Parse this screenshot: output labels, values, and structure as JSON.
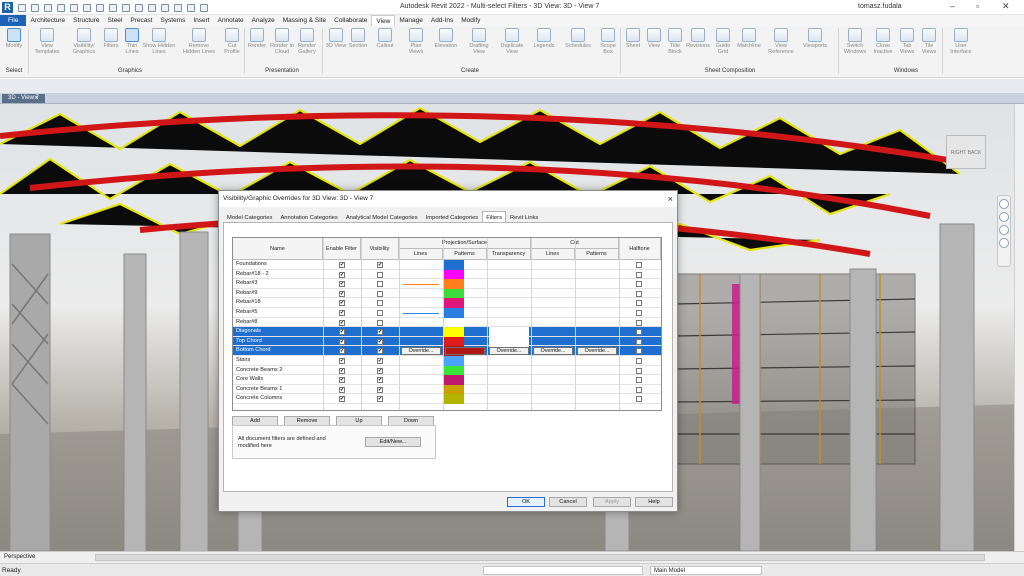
{
  "app": {
    "title": "Autodesk Revit 2022 - Multi-select Filters - 3D View: 3D - View 7",
    "user": "tomasz.fudala"
  },
  "ribbon_tabs": [
    "File",
    "Architecture",
    "Structure",
    "Steel",
    "Precast",
    "Systems",
    "Insert",
    "Annotate",
    "Analyze",
    "Massing & Site",
    "Collaborate",
    "View",
    "Manage",
    "Add-Ins",
    "Modify"
  ],
  "active_tab": "View",
  "ribbon": {
    "buttons": [
      {
        "label": "Modify"
      },
      {
        "label": "View Templates"
      },
      {
        "label": "Visibility/ Graphics"
      },
      {
        "label": "Filters"
      },
      {
        "label": "Thin Lines"
      },
      {
        "label": "Show Hidden Lines"
      },
      {
        "label": "Remove Hidden Lines"
      },
      {
        "label": "Cut Profile"
      },
      {
        "label": "Render"
      },
      {
        "label": "Render in Cloud"
      },
      {
        "label": "Render Gallery"
      },
      {
        "label": "3D View"
      },
      {
        "label": "Section"
      },
      {
        "label": "Callout"
      },
      {
        "label": "Plan Views"
      },
      {
        "label": "Elevation"
      },
      {
        "label": "Drafting View"
      },
      {
        "label": "Duplicate View"
      },
      {
        "label": "Legends"
      },
      {
        "label": "Schedules"
      },
      {
        "label": "Scope Box"
      },
      {
        "label": "Sheet"
      },
      {
        "label": "View"
      },
      {
        "label": "Title Block"
      },
      {
        "label": "Revisions"
      },
      {
        "label": "Guide Grid"
      },
      {
        "label": "Matchline"
      },
      {
        "label": "View Reference"
      },
      {
        "label": "Viewports"
      },
      {
        "label": "Switch Windows"
      },
      {
        "label": "Close Inactive"
      },
      {
        "label": "Tab Views"
      },
      {
        "label": "Tile Views"
      },
      {
        "label": "User Interface"
      }
    ],
    "groups": [
      "Select",
      "Graphics",
      "Presentation",
      "Create",
      "Sheet Composition",
      "Windows"
    ]
  },
  "view_tab": {
    "label": "3D - View 7"
  },
  "dialog": {
    "title": "Visibility/Graphic Overrides for 3D View: 3D - View 7",
    "close": "×",
    "tabs": [
      "Model Categories",
      "Annotation Categories",
      "Analytical Model Categories",
      "Imported Categories",
      "Filters",
      "Revit Links"
    ],
    "active_tab": "Filters",
    "headers": {
      "name": "Name",
      "enable": "Enable Filter",
      "visibility": "Visibility",
      "projection": "Projection/Surface",
      "lines": "Lines",
      "patterns": "Patterns",
      "transparency": "Transparency",
      "cut": "Cut",
      "cut_lines": "Lines",
      "cut_patterns": "Patterns",
      "halftone": "Halftone"
    },
    "rows": [
      {
        "name": "Foundations",
        "enable": true,
        "visible": true,
        "pattern": "#1f6fd1",
        "line": "",
        "selected": false
      },
      {
        "name": "Rebar#18 - 2",
        "enable": true,
        "visible": false,
        "pattern": "#ff00ff",
        "line": "",
        "selected": false
      },
      {
        "name": "Rebar#3",
        "enable": true,
        "visible": false,
        "pattern": "#ff7f1f",
        "line": "#ff7f1f",
        "selected": false
      },
      {
        "name": "Rebar#9",
        "enable": true,
        "visible": false,
        "pattern": "#3cdc3c",
        "line": "",
        "selected": false
      },
      {
        "name": "Rebar#18",
        "enable": true,
        "visible": false,
        "pattern": "#e0157a",
        "line": "",
        "selected": false
      },
      {
        "name": "Rebar#5",
        "enable": true,
        "visible": false,
        "pattern": "#2b7fe0",
        "line": "#2b7fe0",
        "selected": false
      },
      {
        "name": "Rebar#8",
        "enable": true,
        "visible": false,
        "pattern": "#ffffff",
        "line": "",
        "selected": false
      },
      {
        "name": "Diagonals",
        "enable": true,
        "visible": true,
        "pattern": "#ffff00",
        "line": "",
        "selected": true
      },
      {
        "name": "Top Chord",
        "enable": true,
        "visible": true,
        "pattern": "#e01b1b",
        "line": "",
        "selected": true
      },
      {
        "name": "Bottom Chord",
        "enable": true,
        "visible": true,
        "pattern": "#b01818",
        "line": "",
        "selected": true,
        "override": true
      },
      {
        "name": "Stairs",
        "enable": true,
        "visible": true,
        "pattern": "#4aa3ff",
        "line": "",
        "selected": false
      },
      {
        "name": "Concrete Beams 2",
        "enable": true,
        "visible": true,
        "pattern": "#39e539",
        "line": "",
        "selected": false
      },
      {
        "name": "Core Walls",
        "enable": true,
        "visible": true,
        "pattern": "#c01870",
        "line": "",
        "selected": false
      },
      {
        "name": "Concrete Beams 1",
        "enable": true,
        "visible": true,
        "pattern": "#c8a000",
        "line": "",
        "selected": false
      },
      {
        "name": "Concrete Columns",
        "enable": true,
        "visible": true,
        "pattern": "#b4b400",
        "line": "",
        "selected": false
      }
    ],
    "override_label": "Override...",
    "buttons": {
      "add": "Add",
      "remove": "Remove",
      "up": "Up",
      "down": "Down"
    },
    "info_text": "All document filters are defined and modified here",
    "edit_new": "Edit/New...",
    "footer": {
      "ok": "OK",
      "cancel": "Cancel",
      "apply": "Apply",
      "help": "Help"
    }
  },
  "viewport": {
    "mode": "Perspective"
  },
  "status": {
    "text": "Ready",
    "model": "Main Model"
  }
}
